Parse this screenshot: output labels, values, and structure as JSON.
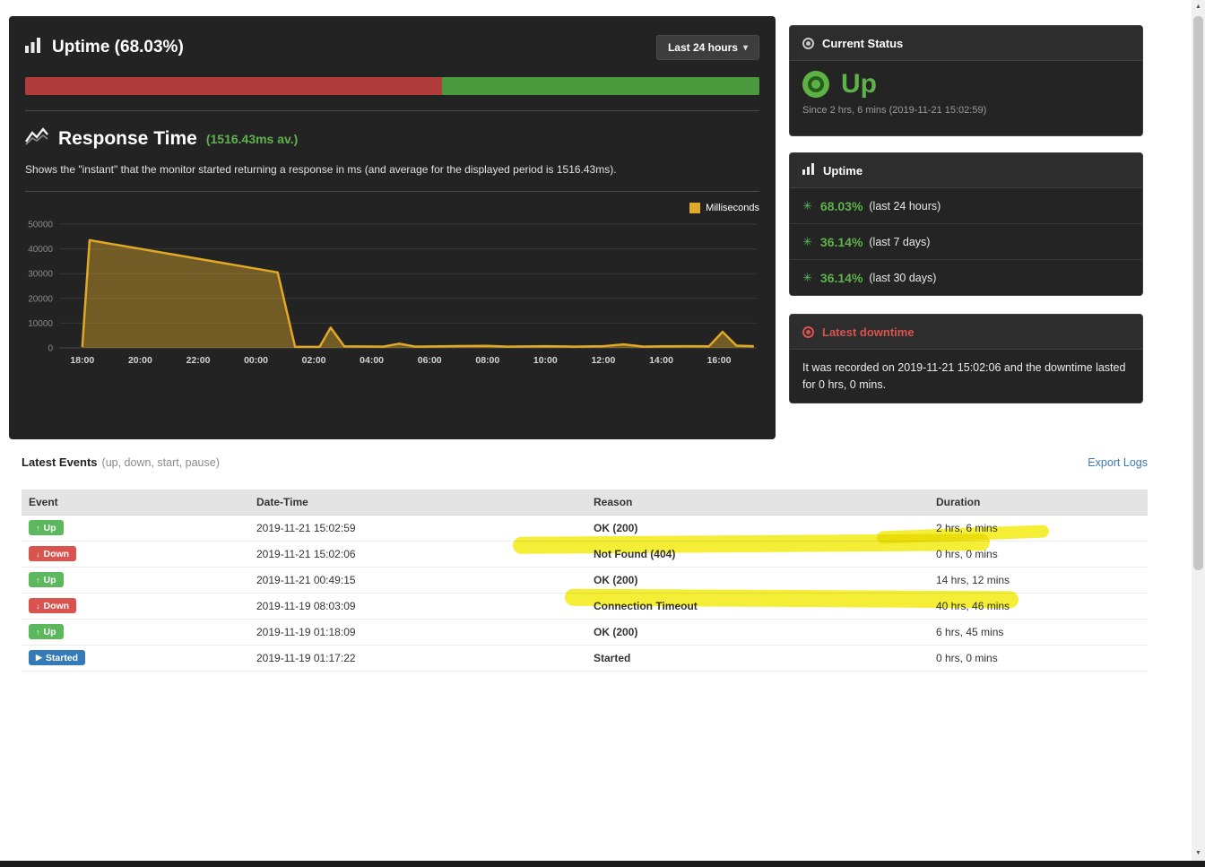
{
  "uptime_panel": {
    "title": "Uptime (68.03%)",
    "range_button": "Last 24 hours",
    "bar_down_fraction": 0.568
  },
  "response_time": {
    "title": "Response Time",
    "subtitle": "(1516.43ms av.)",
    "description": "Shows the \"instant\" that the monitor started returning a response in ms (and average for the displayed period is 1516.43ms).",
    "legend": "Milliseconds"
  },
  "chart_data": {
    "type": "area",
    "title": "Response Time",
    "ylabel": "Milliseconds",
    "y_range": [
      0,
      50000
    ],
    "y_ticks": [
      0,
      10000,
      20000,
      30000,
      40000,
      50000
    ],
    "x_range": [
      0,
      24.1
    ],
    "x_ticks": [
      {
        "x": 0.8,
        "label": "18:00"
      },
      {
        "x": 2.8,
        "label": "20:00"
      },
      {
        "x": 4.8,
        "label": "22:00"
      },
      {
        "x": 6.8,
        "label": "00:00"
      },
      {
        "x": 8.8,
        "label": "02:00"
      },
      {
        "x": 10.8,
        "label": "04:00"
      },
      {
        "x": 12.8,
        "label": "06:00"
      },
      {
        "x": 14.8,
        "label": "08:00"
      },
      {
        "x": 16.8,
        "label": "10:00"
      },
      {
        "x": 18.8,
        "label": "12:00"
      },
      {
        "x": 20.8,
        "label": "14:00"
      },
      {
        "x": 22.8,
        "label": "16:00"
      }
    ],
    "points": [
      [
        0.8,
        400
      ],
      [
        1.05,
        43500
      ],
      [
        7.55,
        30500
      ],
      [
        8.15,
        400
      ],
      [
        9.0,
        400
      ],
      [
        9.38,
        8200
      ],
      [
        9.85,
        600
      ],
      [
        11.2,
        500
      ],
      [
        11.75,
        1700
      ],
      [
        12.3,
        500
      ],
      [
        13.5,
        700
      ],
      [
        14.8,
        800
      ],
      [
        15.5,
        500
      ],
      [
        16.8,
        700
      ],
      [
        17.8,
        500
      ],
      [
        18.8,
        700
      ],
      [
        19.5,
        1400
      ],
      [
        20.2,
        500
      ],
      [
        20.8,
        600
      ],
      [
        21.8,
        700
      ],
      [
        22.45,
        600
      ],
      [
        22.92,
        6500
      ],
      [
        23.4,
        900
      ],
      [
        24.0,
        700
      ]
    ],
    "line_color": "#dfa927",
    "fill_color": "rgba(223,169,39,0.42)",
    "grid": true,
    "legend_position": "top-right"
  },
  "current_status": {
    "title": "Current Status",
    "status": "Up",
    "since": "Since 2 hrs, 6 mins (2019-11-21 15:02:59)"
  },
  "uptime_stats": {
    "title": "Uptime",
    "rows": [
      {
        "pct": "68.03%",
        "label": "(last 24 hours)"
      },
      {
        "pct": "36.14%",
        "label": "(last 7 days)"
      },
      {
        "pct": "36.14%",
        "label": "(last 30 days)"
      }
    ]
  },
  "latest_downtime": {
    "title": "Latest downtime",
    "text": "It was recorded on 2019-11-21 15:02:06 and the downtime lasted for 0 hrs, 0 mins."
  },
  "events": {
    "title": "Latest Events",
    "subtitle": "(up, down, start, pause)",
    "export_link": "Export Logs",
    "columns": [
      "Event",
      "Date-Time",
      "Reason",
      "Duration"
    ],
    "rows": [
      {
        "event": "Up",
        "type": "up",
        "datetime": "2019-11-21 15:02:59",
        "reason": "OK (200)",
        "reason_type": "ok",
        "duration": "2 hrs, 6 mins",
        "highlighted": false
      },
      {
        "event": "Down",
        "type": "down",
        "datetime": "2019-11-21 15:02:06",
        "reason": "Not Found (404)",
        "reason_type": "error",
        "duration": "0 hrs, 0 mins",
        "highlighted": true
      },
      {
        "event": "Up",
        "type": "up",
        "datetime": "2019-11-21 00:49:15",
        "reason": "OK (200)",
        "reason_type": "ok",
        "duration": "14 hrs, 12 mins",
        "highlighted": false
      },
      {
        "event": "Down",
        "type": "down",
        "datetime": "2019-11-19 08:03:09",
        "reason": "Connection Timeout",
        "reason_type": "error",
        "duration": "40 hrs, 46 mins",
        "highlighted": true
      },
      {
        "event": "Up",
        "type": "up",
        "datetime": "2019-11-19 01:18:09",
        "reason": "OK (200)",
        "reason_type": "ok",
        "duration": "6 hrs, 45 mins",
        "highlighted": false
      },
      {
        "event": "Started",
        "type": "started",
        "datetime": "2019-11-19 01:17:22",
        "reason": "Started",
        "reason_type": "neutral",
        "duration": "0 hrs, 0 mins",
        "highlighted": false
      }
    ]
  },
  "icons": {
    "up": "↑",
    "down": "↓",
    "started": "▶"
  },
  "colors": {
    "up_green": "#5cb85c",
    "down_red": "#d9534f",
    "started_blue": "#337ab7",
    "accent_green": "#5fb14a",
    "chart_gold": "#dfa927",
    "bar_red": "#b13c3c",
    "bar_green": "#4a9a3d",
    "link_blue": "#3879b5",
    "highlight_yellow": "#f2ea0a",
    "panel_bg": "#232323"
  }
}
